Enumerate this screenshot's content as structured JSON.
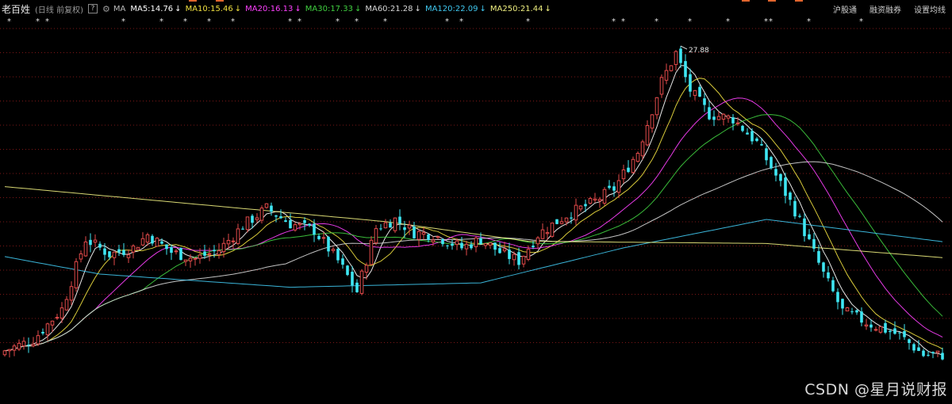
{
  "header": {
    "stock_name": "老百姓",
    "mode": "(日线 前复权)",
    "help": "?",
    "ma_label": "MA",
    "ma_items": [
      {
        "text": "MA5:14.76",
        "color": "#ffffff"
      },
      {
        "text": "MA10:15.46",
        "color": "#f0e040"
      },
      {
        "text": "MA20:16.13",
        "color": "#ff40ff"
      },
      {
        "text": "MA30:17.33",
        "color": "#40d040"
      },
      {
        "text": "MA60:21.28",
        "color": "#d8d8d8"
      },
      {
        "text": "MA120:22.09",
        "color": "#40c8f0"
      },
      {
        "text": "MA250:21.44",
        "color": "#f0f080"
      }
    ],
    "right_menu": [
      "沪股通",
      "融资融券",
      "设置均线"
    ]
  },
  "chart_data": {
    "type": "candlestick",
    "title": "老百姓",
    "period": "日线 前复权",
    "y_range": [
      12.4,
      27.9
    ],
    "grid": "horizontal dashed",
    "max_label": "27.88",
    "candle_count": 198,
    "ohlc_anchor_closes": [
      [
        0,
        13.1
      ],
      [
        6,
        13.6
      ],
      [
        12,
        15.0
      ],
      [
        17,
        18.2
      ],
      [
        22,
        17.5
      ],
      [
        27,
        17.8
      ],
      [
        30,
        18.4
      ],
      [
        35,
        17.6
      ],
      [
        40,
        17.3
      ],
      [
        45,
        17.7
      ],
      [
        50,
        18.8
      ],
      [
        55,
        19.6
      ],
      [
        60,
        18.9
      ],
      [
        65,
        18.6
      ],
      [
        70,
        17.2
      ],
      [
        74,
        15.8
      ],
      [
        78,
        18.7
      ],
      [
        82,
        19.1
      ],
      [
        86,
        18.5
      ],
      [
        90,
        18.4
      ],
      [
        96,
        17.8
      ],
      [
        100,
        18.2
      ],
      [
        104,
        17.6
      ],
      [
        108,
        17.2
      ],
      [
        112,
        18.4
      ],
      [
        118,
        19.3
      ],
      [
        123,
        19.8
      ],
      [
        128,
        20.5
      ],
      [
        133,
        22.2
      ],
      [
        138,
        25.4
      ],
      [
        141,
        26.7
      ],
      [
        144,
        25.0
      ],
      [
        148,
        23.9
      ],
      [
        153,
        23.7
      ],
      [
        158,
        22.6
      ],
      [
        162,
        21.1
      ],
      [
        166,
        19.5
      ],
      [
        172,
        16.6
      ],
      [
        176,
        14.9
      ],
      [
        182,
        14.3
      ],
      [
        188,
        13.8
      ],
      [
        193,
        12.9
      ],
      [
        197,
        12.9
      ]
    ],
    "ma_series": [
      {
        "name": "MA5",
        "period": 5,
        "color": "#ffffff"
      },
      {
        "name": "MA10",
        "period": 10,
        "color": "#f0e040"
      },
      {
        "name": "MA20",
        "period": 20,
        "color": "#ff40ff"
      },
      {
        "name": "MA30",
        "period": 30,
        "color": "#40d040"
      },
      {
        "name": "MA60",
        "period": 60,
        "color": "#d8d8d8"
      },
      {
        "name": "MA120",
        "period": 120,
        "color": "#40c8f0",
        "points": [
          [
            0,
            17.4
          ],
          [
            20,
            16.6
          ],
          [
            60,
            16.0
          ],
          [
            100,
            16.2
          ],
          [
            130,
            17.8
          ],
          [
            160,
            19.1
          ],
          [
            200,
            18.0
          ]
        ]
      },
      {
        "name": "MA250",
        "period": 250,
        "color": "#f0f080",
        "points": [
          [
            0,
            20.6
          ],
          [
            40,
            19.8
          ],
          [
            80,
            19.0
          ],
          [
            110,
            18.1
          ],
          [
            160,
            18.0
          ],
          [
            200,
            17.3
          ]
        ]
      }
    ],
    "colors": {
      "up": "#e24a4a",
      "down": "#3ee6f2",
      "grid": "#8b1a1a",
      "star": "#e0e0e0"
    }
  },
  "watermark": "CSDN @星月说财报"
}
